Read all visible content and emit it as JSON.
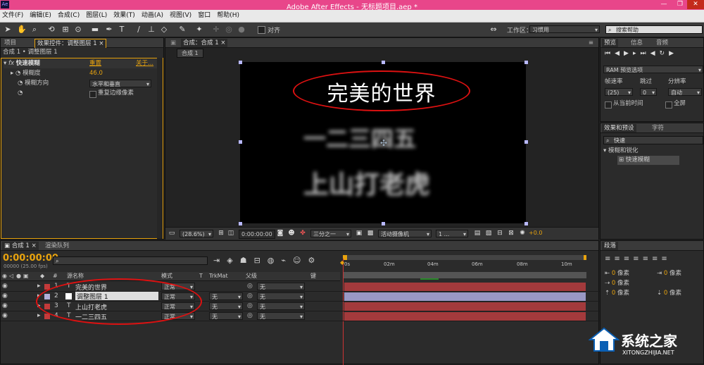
{
  "window": {
    "title": "Adobe After Effects - 无标题项目.aep *",
    "logo": "Ae"
  },
  "menu": [
    "文件(F)",
    "编辑(E)",
    "合成(C)",
    "图层(L)",
    "效果(T)",
    "动画(A)",
    "视图(V)",
    "窗口",
    "帮助(H)"
  ],
  "toolbar": {
    "align_label": "对齐",
    "workspace_label": "工作区：",
    "workspace_value": "习惯用",
    "help_search_placeholder": "搜索帮助"
  },
  "left_panel": {
    "tabs": [
      "项目",
      "效果控件：调整图层 1"
    ],
    "subtitle": "合成 1 • 调整图层 1",
    "effect": {
      "name": "快速模糊",
      "reset": "重置",
      "about": "关于..."
    },
    "props": [
      {
        "label": "模糊度",
        "value": "46.0"
      },
      {
        "label": "模糊方向",
        "value": "水平和垂直"
      },
      {
        "label": "",
        "value": "重复边缘像素"
      }
    ]
  },
  "comp_panel": {
    "tab": "合成：合成 1",
    "breadcrumb": "合成 1",
    "text_main": "完美的世界",
    "text_blur1": "一二三四五",
    "text_blur2": "上山打老虎",
    "footer": {
      "zoom": "(28.6%)",
      "timecode": "0:00:00:00",
      "resolution": "三分之一",
      "camera": "活动摄像机",
      "views": "1 ...",
      "exposure": "+0.0"
    }
  },
  "right_panel": {
    "tabs": [
      "预览",
      "信息",
      "音频"
    ],
    "ram_preview": "RAM 预览选项",
    "fps_label": "帧速率",
    "fps_value": "(25)",
    "skip_label": "跳过",
    "skip_value": "0",
    "res_label": "分辨率",
    "res_value": "自动",
    "from_current": "从当前时间",
    "fullscreen": "全屏",
    "effects_tabs": [
      "效果和预设",
      "字符"
    ],
    "effects_search": "快速",
    "effects_category": "模糊和锐化",
    "effects_item": "快速模糊",
    "paragraph_tab": "段落",
    "px_label": "像素",
    "px_values": [
      "0",
      "0",
      "0",
      "0",
      "0"
    ]
  },
  "timeline": {
    "tabs": [
      "合成 1",
      "渲染队列"
    ],
    "timecode": "0:00:00:00",
    "fps": "00000 (25.00 fps)",
    "search_placeholder": "",
    "headers": {
      "num": "#",
      "name": "源名称",
      "mode": "模式",
      "t": "T",
      "trkmat": "TrkMat",
      "parent": "父级",
      "key": "键"
    },
    "ruler": [
      "0s",
      "02m",
      "04m",
      "06m",
      "08m",
      "10m"
    ],
    "layers": [
      {
        "num": "1",
        "name": "完美的世界",
        "mode": "正常",
        "trkmat": "",
        "parent": "无",
        "color": "#c23a3a"
      },
      {
        "num": "2",
        "name": "调整图层 1",
        "mode": "正常",
        "trkmat": "无",
        "parent": "无",
        "color": "#b0b0d8"
      },
      {
        "num": "3",
        "name": "上山打老虎",
        "mode": "正常",
        "trkmat": "无",
        "parent": "无",
        "color": "#c23a3a"
      },
      {
        "num": "4",
        "name": "一二三四五",
        "mode": "正常",
        "trkmat": "无",
        "parent": "无",
        "color": "#c23a3a"
      }
    ]
  },
  "watermark": {
    "text": "系统之家",
    "url": "XITONGZHIJIA.NET"
  }
}
